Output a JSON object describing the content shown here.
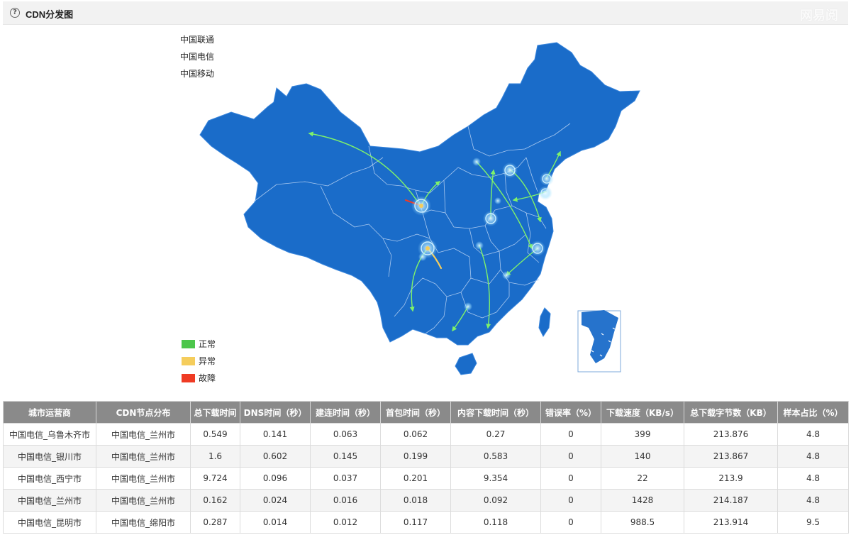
{
  "panel": {
    "help_icon": "?",
    "title": "CDN分发图",
    "watermark": "网易阅"
  },
  "operator_legend": [
    "中国联通",
    "中国电信",
    "中国移动"
  ],
  "status_legend": [
    {
      "label": "正常",
      "color": "#4cc64b"
    },
    {
      "label": "异常",
      "color": "#f5cd5c"
    },
    {
      "label": "故障",
      "color": "#ef3b24"
    }
  ],
  "colors": {
    "map_fill": "#1a6cc9",
    "province_border": "#aac9ef",
    "flow_normal": "#7ff26a",
    "flow_abnormal": "#f5cd5c",
    "flow_fault": "#ef3b24",
    "node_halo": "#9fe0ff"
  },
  "table": {
    "columns": [
      "城市运营商",
      "CDN节点分布",
      "总下载时间",
      "DNS时间（秒）",
      "建连时间（秒）",
      "首包时间（秒）",
      "内容下载时间（秒）",
      "错误率（%）",
      "下载速度（KB/s）",
      "总下载字节数（KB）",
      "样本占比（%）"
    ],
    "rows": [
      [
        "中国电信_乌鲁木齐市",
        "中国电信_兰州市",
        "0.549",
        "0.141",
        "0.063",
        "0.062",
        "0.27",
        "0",
        "399",
        "213.876",
        "4.8"
      ],
      [
        "中国电信_银川市",
        "中国电信_兰州市",
        "1.6",
        "0.602",
        "0.145",
        "0.199",
        "0.583",
        "0",
        "140",
        "213.867",
        "4.8"
      ],
      [
        "中国电信_西宁市",
        "中国电信_兰州市",
        "9.724",
        "0.096",
        "0.037",
        "0.201",
        "9.354",
        "0",
        "22",
        "213.9",
        "4.8"
      ],
      [
        "中国电信_兰州市",
        "中国电信_兰州市",
        "0.162",
        "0.024",
        "0.016",
        "0.018",
        "0.092",
        "0",
        "1428",
        "214.187",
        "4.8"
      ],
      [
        "中国电信_昆明市",
        "中国电信_绵阳市",
        "0.287",
        "0.014",
        "0.012",
        "0.117",
        "0.118",
        "0",
        "988.5",
        "213.914",
        "9.5"
      ]
    ]
  }
}
